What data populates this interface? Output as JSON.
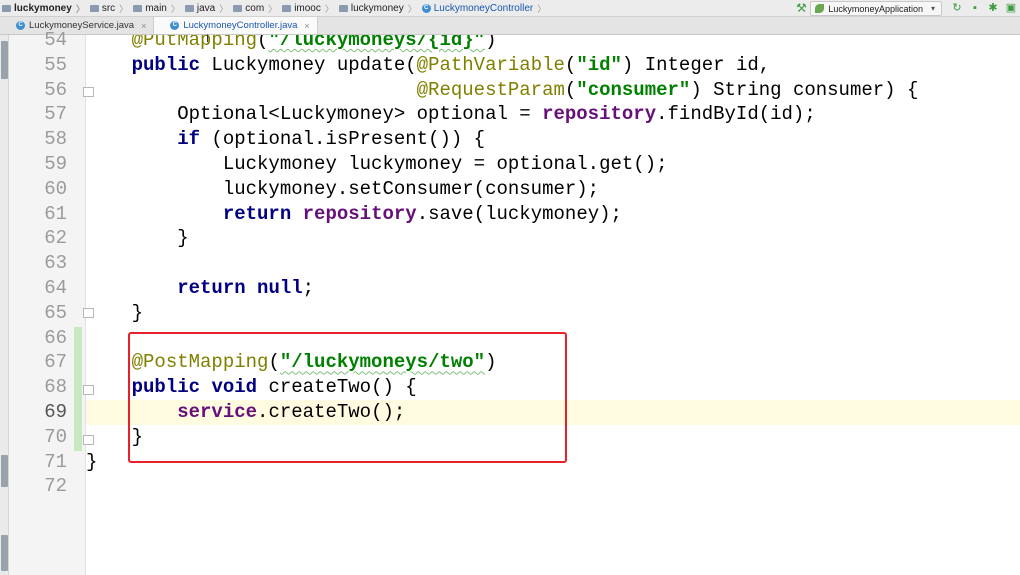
{
  "breadcrumb": {
    "items": [
      {
        "label": "luckymoney",
        "kind": "project"
      },
      {
        "label": "src",
        "kind": "folder"
      },
      {
        "label": "main",
        "kind": "folder"
      },
      {
        "label": "java",
        "kind": "folder"
      },
      {
        "label": "com",
        "kind": "folder"
      },
      {
        "label": "imooc",
        "kind": "folder"
      },
      {
        "label": "luckymoney",
        "kind": "folder"
      },
      {
        "label": "LuckymoneyController",
        "kind": "class"
      }
    ]
  },
  "toolbar": {
    "build_icon": "hammer-icon",
    "run_config": "LuckymoneyApplication",
    "buttons": [
      "rerun-icon",
      "stop-icon",
      "debug-icon",
      "coverage-icon"
    ]
  },
  "tabs": [
    {
      "label": "LuckymoneyService.java",
      "active": false
    },
    {
      "label": "LuckymoneyController.java",
      "active": true
    }
  ],
  "editor": {
    "current_line": 69,
    "highlight_color": "#e8202a",
    "lines": [
      {
        "n": "54",
        "tokens": [
          {
            "t": "    "
          },
          {
            "t": "@PutMapping",
            "c": "an"
          },
          {
            "t": "("
          },
          {
            "t": "\"/luckymoneys/{id}\"",
            "c": "str"
          },
          {
            "t": ")"
          }
        ]
      },
      {
        "n": "55",
        "tokens": [
          {
            "t": "    "
          },
          {
            "t": "public",
            "c": "kw"
          },
          {
            "t": " Luckymoney update("
          },
          {
            "t": "@PathVariable",
            "c": "an"
          },
          {
            "t": "("
          },
          {
            "t": "\"id\"",
            "c": "str"
          },
          {
            "t": ") Integer id,"
          }
        ]
      },
      {
        "n": "56",
        "tokens": [
          {
            "t": "                             "
          },
          {
            "t": "@RequestParam",
            "c": "an"
          },
          {
            "t": "("
          },
          {
            "t": "\"consumer\"",
            "c": "str"
          },
          {
            "t": ") String consumer) {"
          }
        ]
      },
      {
        "n": "57",
        "tokens": [
          {
            "t": "        Optional<Luckymoney> optional = "
          },
          {
            "t": "repository",
            "c": "fld"
          },
          {
            "t": ".findById(id);"
          }
        ]
      },
      {
        "n": "58",
        "tokens": [
          {
            "t": "        "
          },
          {
            "t": "if",
            "c": "kw"
          },
          {
            "t": " (optional.isPresent()) {"
          }
        ]
      },
      {
        "n": "59",
        "tokens": [
          {
            "t": "            Luckymoney luckymoney = optional.get();"
          }
        ]
      },
      {
        "n": "60",
        "tokens": [
          {
            "t": "            luckymoney.setConsumer(consumer);"
          }
        ]
      },
      {
        "n": "61",
        "tokens": [
          {
            "t": "            "
          },
          {
            "t": "return",
            "c": "kw"
          },
          {
            "t": " "
          },
          {
            "t": "repository",
            "c": "fld"
          },
          {
            "t": ".save(luckymoney);"
          }
        ]
      },
      {
        "n": "62",
        "tokens": [
          {
            "t": "        }"
          }
        ]
      },
      {
        "n": "63",
        "tokens": []
      },
      {
        "n": "64",
        "tokens": [
          {
            "t": "        "
          },
          {
            "t": "return",
            "c": "kw"
          },
          {
            "t": " "
          },
          {
            "t": "null",
            "c": "kw"
          },
          {
            "t": ";"
          }
        ]
      },
      {
        "n": "65",
        "tokens": [
          {
            "t": "    }"
          }
        ]
      },
      {
        "n": "66",
        "tokens": []
      },
      {
        "n": "67",
        "tokens": [
          {
            "t": "    "
          },
          {
            "t": "@PostMapping",
            "c": "an"
          },
          {
            "t": "("
          },
          {
            "t": "\"/luckymoneys/two\"",
            "c": "str"
          },
          {
            "t": ")"
          }
        ]
      },
      {
        "n": "68",
        "tokens": [
          {
            "t": "    "
          },
          {
            "t": "public",
            "c": "kw"
          },
          {
            "t": " "
          },
          {
            "t": "void",
            "c": "kw"
          },
          {
            "t": " createTwo() {"
          }
        ]
      },
      {
        "n": "69",
        "tokens": [
          {
            "t": "        "
          },
          {
            "t": "service",
            "c": "fld"
          },
          {
            "t": ".createTwo();"
          }
        ]
      },
      {
        "n": "70",
        "tokens": [
          {
            "t": "    }"
          }
        ]
      },
      {
        "n": "71",
        "tokens": [
          {
            "t": "}"
          }
        ]
      },
      {
        "n": "72",
        "tokens": []
      }
    ]
  }
}
